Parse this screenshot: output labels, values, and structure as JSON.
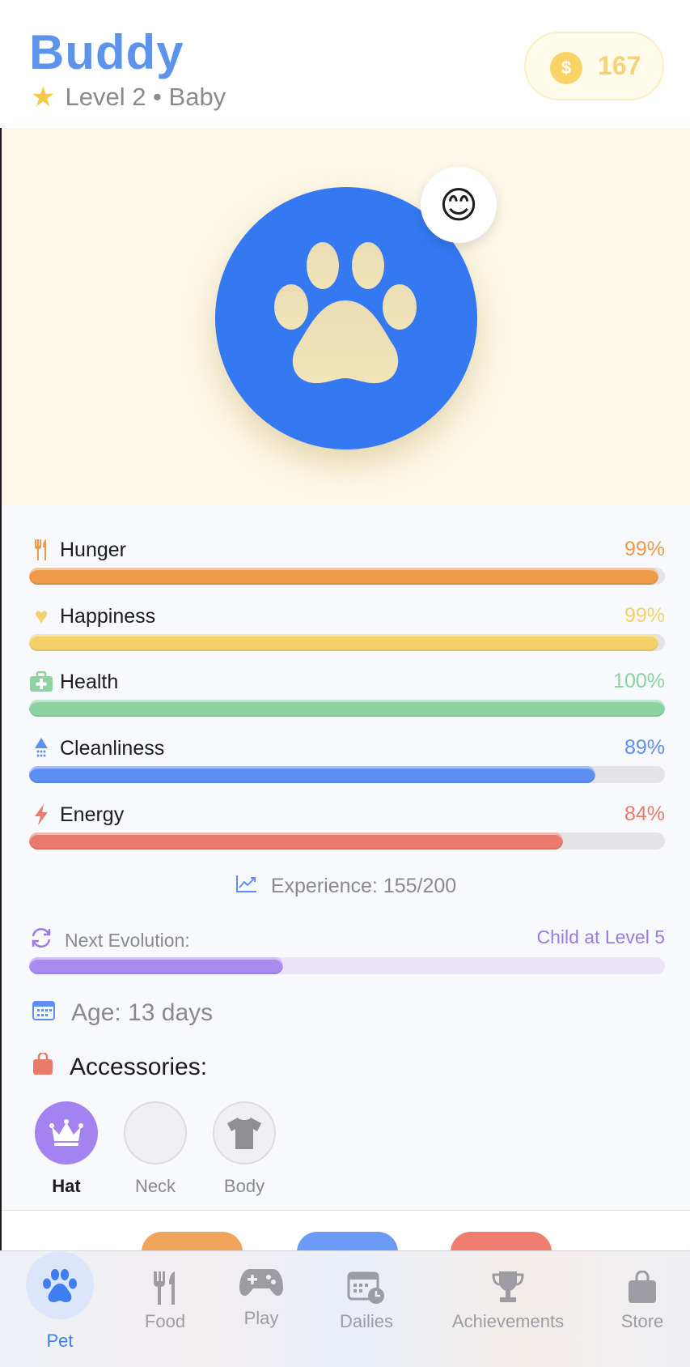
{
  "header": {
    "pet_name": "Buddy",
    "level_text": "Level 2 • Baby",
    "coins": "167",
    "coin_symbol": "$"
  },
  "pet": {
    "mood_emoji": "😊",
    "avatar_icon": "paw-icon"
  },
  "stats": [
    {
      "label": "Hunger",
      "value": "99%",
      "percent": 99,
      "color": "#ee9a4a",
      "icon": "fork-knife-icon"
    },
    {
      "label": "Happiness",
      "value": "99%",
      "percent": 99,
      "color": "#f3d069",
      "icon": "heart-icon"
    },
    {
      "label": "Health",
      "value": "100%",
      "percent": 100,
      "color": "#8bd3a0",
      "icon": "medkit-icon"
    },
    {
      "label": "Cleanliness",
      "value": "89%",
      "percent": 89,
      "color": "#5d8ef2",
      "icon": "shower-icon"
    },
    {
      "label": "Energy",
      "value": "84%",
      "percent": 84,
      "color": "#ea7b6c",
      "icon": "bolt-icon"
    }
  ],
  "experience": {
    "text": "Experience: 155/200"
  },
  "evolution": {
    "label": "Next Evolution:",
    "target": "Child at Level 5",
    "percent": 40,
    "color": "#a98cef"
  },
  "age": {
    "text": "Age: 13 days"
  },
  "accessories": {
    "title": "Accessories:",
    "items": [
      {
        "label": "Hat",
        "selected": true,
        "icon": "crown-icon"
      },
      {
        "label": "Neck",
        "selected": false,
        "icon": ""
      },
      {
        "label": "Body",
        "selected": false,
        "icon": "shirt-icon"
      }
    ]
  },
  "tabs": [
    {
      "label": "Pet",
      "icon": "paw-icon",
      "active": true
    },
    {
      "label": "Food",
      "icon": "fork-knife-icon",
      "active": false
    },
    {
      "label": "Play",
      "icon": "gamepad-icon",
      "active": false
    },
    {
      "label": "Dailies",
      "icon": "calendar-clock-icon",
      "active": false
    },
    {
      "label": "Achievements",
      "icon": "trophy-icon",
      "active": false
    },
    {
      "label": "Store",
      "icon": "bag-icon",
      "active": false
    }
  ],
  "colors": {
    "accent": "#3e7ef0",
    "pet_circle": "#3479f2",
    "action_orange": "#f0a35a",
    "action_blue": "#6b9bf5",
    "action_red": "#ee7e70"
  }
}
